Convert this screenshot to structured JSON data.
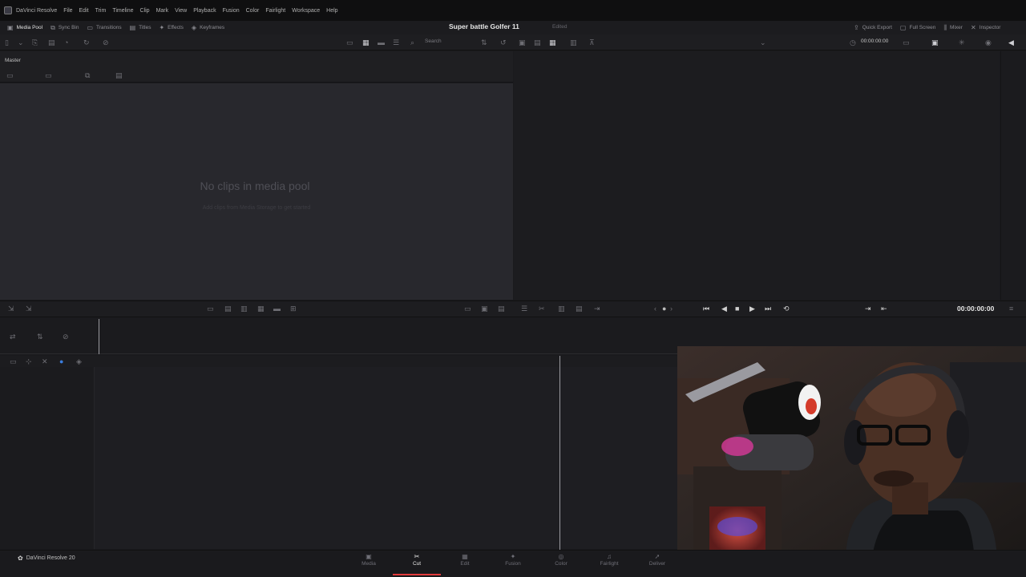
{
  "menu": {
    "app_title": "DaVinci Resolve",
    "items": [
      "File",
      "Edit",
      "Trim",
      "Timeline",
      "Clip",
      "Mark",
      "View",
      "Playback",
      "Fusion",
      "Color",
      "Fairlight",
      "Workspace",
      "Help"
    ]
  },
  "toolbar": {
    "left": [
      {
        "label": "Media Pool",
        "icon": "media-pool-icon"
      },
      {
        "label": "Sync Bin",
        "icon": "sync-bin-icon"
      },
      {
        "label": "Transitions",
        "icon": "transitions-icon"
      },
      {
        "label": "Titles",
        "icon": "titles-icon"
      },
      {
        "label": "Effects",
        "icon": "effects-icon"
      },
      {
        "label": "Keyframes",
        "icon": "keyframes-icon"
      }
    ],
    "right": [
      {
        "label": "Quick Export",
        "icon": "export-icon"
      },
      {
        "label": "Full Screen",
        "icon": "fullscreen-icon"
      },
      {
        "label": "Mixer",
        "icon": "mixer-icon"
      },
      {
        "label": "Inspector",
        "icon": "inspector-icon"
      }
    ]
  },
  "project": {
    "title": "Super battle Golfer 11",
    "status": "Edited"
  },
  "search": {
    "placeholder": "Search"
  },
  "viewer": {
    "timecode_top": "00:00:00:00",
    "timecode_transport": "00:00:00:00"
  },
  "media_pool": {
    "bin": "Master",
    "empty_title": "No clips in media pool",
    "empty_subtitle": "Add clips from Media Storage to get started"
  },
  "pages": [
    {
      "label": "Media",
      "icon": "media-page-icon",
      "active": false
    },
    {
      "label": "Cut",
      "icon": "cut-page-icon",
      "active": true
    },
    {
      "label": "Edit",
      "icon": "edit-page-icon",
      "active": false
    },
    {
      "label": "Fusion",
      "icon": "fusion-page-icon",
      "active": false
    },
    {
      "label": "Color",
      "icon": "color-page-icon",
      "active": false
    },
    {
      "label": "Fairlight",
      "icon": "fairlight-page-icon",
      "active": false
    },
    {
      "label": "Deliver",
      "icon": "deliver-page-icon",
      "active": false
    }
  ],
  "brand": {
    "label": "DaVinci Resolve 20"
  },
  "colors": {
    "accent": "#e23b3b",
    "background": "#1a1a1d",
    "panel": "#28282d"
  }
}
